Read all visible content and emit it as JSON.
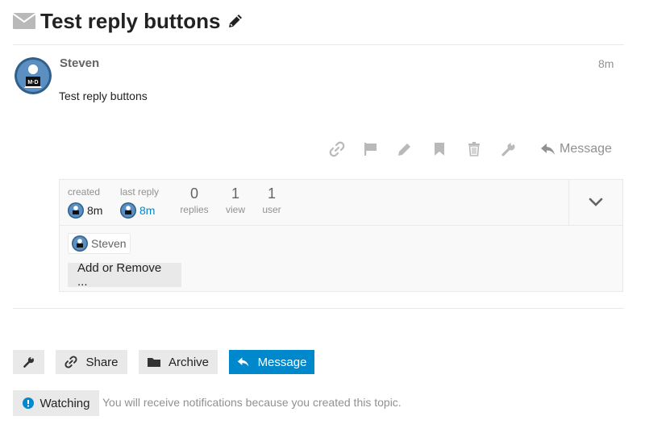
{
  "topic": {
    "title": "Test reply buttons"
  },
  "post": {
    "username": "Steven",
    "time": "8m",
    "body": "Test reply buttons",
    "actions": {
      "message_label": "Message"
    }
  },
  "topic_map": {
    "created_label": "created",
    "created_time": "8m",
    "last_reply_label": "last reply",
    "last_reply_time": "8m",
    "replies_count": "0",
    "replies_label": "replies",
    "views_count": "1",
    "views_label": "view",
    "users_count": "1",
    "users_label": "user",
    "participant": "Steven",
    "add_remove_label": "Add or Remove ..."
  },
  "footer": {
    "share_label": "Share",
    "archive_label": "Archive",
    "message_label": "Message",
    "watching_label": "Watching",
    "notice": "You will receive notifications because you created this topic."
  },
  "colors": {
    "accent": "#0088cc",
    "muted": "#919191",
    "icon": "#b9b9b9"
  },
  "icons": [
    "envelope-icon",
    "pencil-icon",
    "link-icon",
    "flag-icon",
    "edit-icon",
    "bookmark-icon",
    "trash-icon",
    "wrench-icon",
    "reply-icon",
    "chevron-down-icon",
    "folder-icon",
    "exclamation-circle-icon"
  ]
}
